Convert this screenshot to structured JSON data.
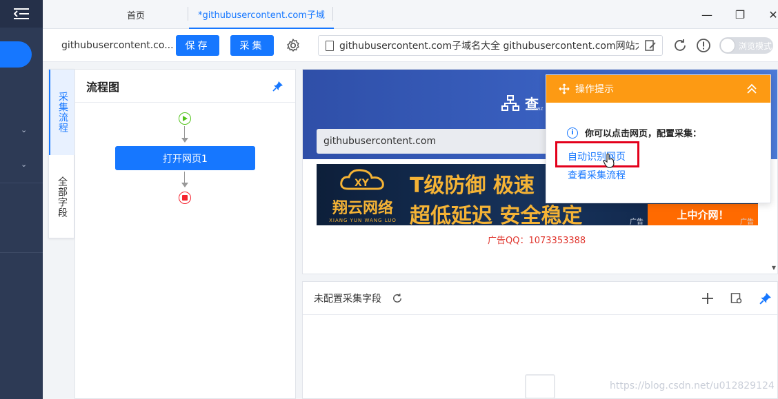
{
  "window": {
    "tabs": [
      {
        "label": "首页"
      },
      {
        "label": "*githubusercontent.com子域"
      }
    ],
    "controls": {
      "minimize": "—",
      "maximize": "❐",
      "close": "✕"
    }
  },
  "toolbar": {
    "task_name": "githubusercontent.co...",
    "save_label": "保存",
    "collect_label": "采集",
    "url_text": "githubusercontent.com子域名大全 githubusercontent.com网站大全 ...",
    "browse_mode_label": "浏览模式"
  },
  "side_tabs": [
    {
      "label": "采集流程"
    },
    {
      "label": "全部字段"
    }
  ],
  "flowchart": {
    "title": "流程图",
    "node_label": "打开网页1"
  },
  "preview": {
    "logo_text": "查",
    "logo_sub": "chaz",
    "search_value": "githubusercontent.com",
    "banner": {
      "brand_name": "翔云网络",
      "brand_pinyin": "XIANG YUN WANG LUO",
      "brand_mark": "XY",
      "line1": "T级防御  极速",
      "line2": "超低延迟  安全稳定",
      "right_text": "上中介网！",
      "ad_mark": "广告"
    },
    "ad_qq": "广告QQ：1073353388"
  },
  "tip_popup": {
    "title": "操作提示",
    "info_text": "你可以点击网页，配置采集：",
    "link_auto": "自动识别网页",
    "link_flow": "查看采集流程"
  },
  "fields_panel": {
    "title": "未配置采集字段"
  },
  "watermark": "https://blog.csdn.net/u012829124",
  "colors": {
    "accent": "#1677ff",
    "nav_bg": "#2d3a55",
    "tip_orange": "#fd9a13",
    "highlight_red": "#e3001b"
  }
}
